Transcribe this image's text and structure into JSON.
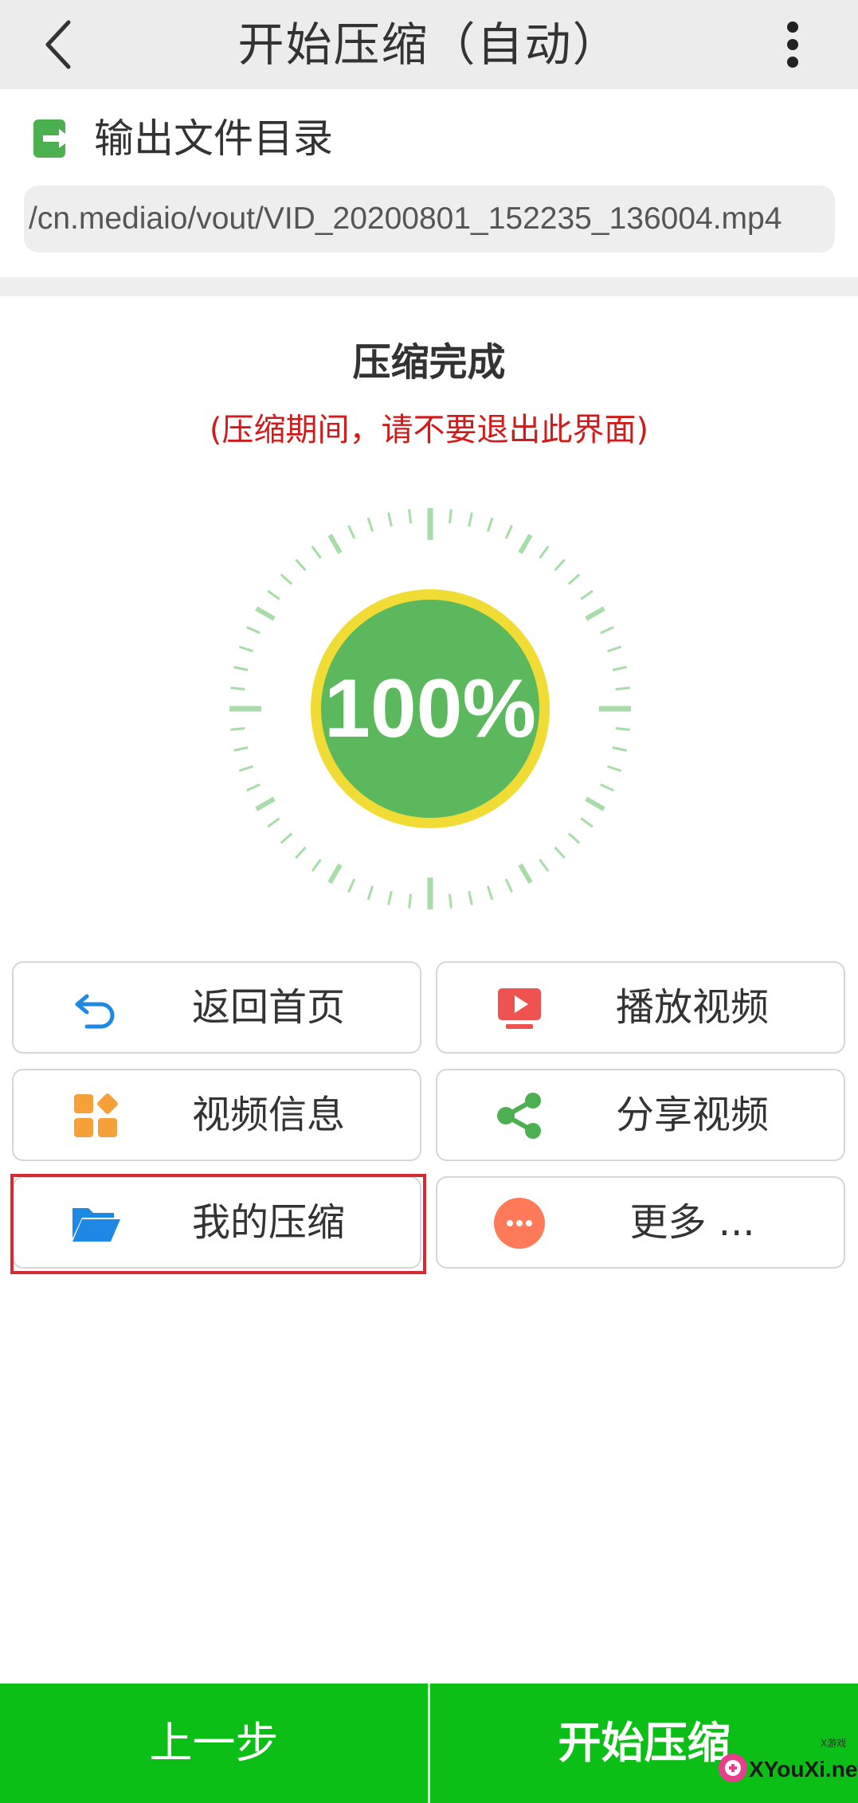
{
  "header": {
    "title": "开始压缩（自动）",
    "back_icon": "chevron-left-icon",
    "menu_icon": "more-vert-icon"
  },
  "output": {
    "label": "输出文件目录",
    "icon": "export-icon",
    "icon_color": "#4caf50",
    "path": "/cn.mediaio/vout/VID_20200801_152235_136004.mp4"
  },
  "status": {
    "title": "压缩完成",
    "note": "(压缩期间，请不要退出此界面)",
    "note_color": "#d01b1b",
    "progress_label": "100%",
    "progress_fraction": 1.0,
    "ring_color": "#f0dc34",
    "fill_color": "#5cb85c",
    "tick_color": "#a8dca8"
  },
  "actions": [
    {
      "label": "返回首页",
      "icon": "undo-icon",
      "color": "#1e88e5"
    },
    {
      "label": "播放视频",
      "icon": "play-video-icon",
      "color": "#ef5350"
    },
    {
      "label": "视频信息",
      "icon": "apps-grid-icon",
      "color": "#f5a038"
    },
    {
      "label": "分享视频",
      "icon": "share-icon",
      "color": "#4caf50"
    },
    {
      "label": "我的压缩",
      "icon": "folder-open-icon",
      "color": "#1e88e5"
    },
    {
      "label": "更多 ...",
      "icon": "more-horiz-icon",
      "color": "#ff7a59"
    }
  ],
  "footer": {
    "prev_label": "上一步",
    "start_label": "开始压缩",
    "bg_color": "#0cbf16"
  },
  "watermark": {
    "top_text": "X游戏",
    "text": "XYouXi.net"
  }
}
